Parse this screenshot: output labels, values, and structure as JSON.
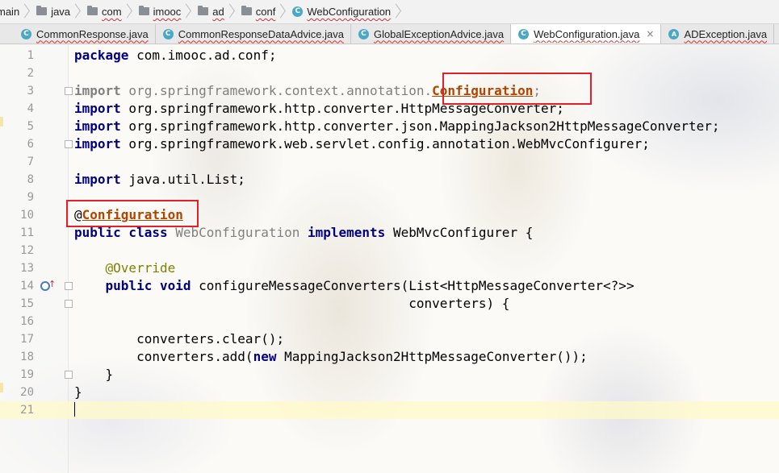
{
  "breadcrumb": [
    {
      "label": "main",
      "icon": "folder-icon"
    },
    {
      "label": "java",
      "icon": "folder-icon"
    },
    {
      "label": "com",
      "icon": "folder-icon"
    },
    {
      "label": "imooc",
      "icon": "folder-icon"
    },
    {
      "label": "ad",
      "icon": "folder-icon"
    },
    {
      "label": "conf",
      "icon": "folder-icon"
    },
    {
      "label": "WebConfiguration",
      "icon": "class-icon",
      "icon_glyph": "C"
    }
  ],
  "tabs": [
    {
      "label": "CommonResponse.java",
      "icon_glyph": "C",
      "active": false
    },
    {
      "label": "CommonResponseDataAdvice.java",
      "icon_glyph": "C",
      "active": false
    },
    {
      "label": "GlobalExceptionAdvice.java",
      "icon_glyph": "C",
      "active": false
    },
    {
      "label": "WebConfiguration.java",
      "icon_glyph": "C",
      "active": true,
      "close": "×"
    },
    {
      "label": "ADException.java",
      "icon_glyph": "A",
      "active": false
    }
  ],
  "editor": {
    "line_numbers": [
      "1",
      "2",
      "3",
      "4",
      "5",
      "6",
      "7",
      "8",
      "9",
      "10",
      "11",
      "12",
      "13",
      "14",
      "15",
      "16",
      "17",
      "18",
      "19",
      "20",
      "21"
    ],
    "code": {
      "l1_kw": "package",
      "l1_rest": " com.imooc.ad.conf;",
      "l3_kw": "import",
      "l3_pkg": " org.springframework.context.annotation.",
      "l3_cls": "Configuration",
      "l3_semi": ";",
      "l4_kw": "import",
      "l4_rest": " org.springframework.http.converter.HttpMessageConverter;",
      "l5_kw": "import",
      "l5_rest": " org.springframework.http.converter.json.MappingJackson2HttpMessageConverter;",
      "l6_kw": "import",
      "l6_rest": " org.springframework.web.servlet.config.annotation.WebMvcConfigurer;",
      "l8_kw": "import",
      "l8_rest": " java.util.List;",
      "l10_at": "@",
      "l10_name": "Configuration",
      "l11_kw1": "public class",
      "l11_name": " WebConfiguration ",
      "l11_kw2": "implements",
      "l11_rest": " WebMvcConfigurer {",
      "l13_ann": "    @Override",
      "l14_kw": "    public void",
      "l14_rest": " configureMessageConverters(List<HttpMessageConverter<?>>",
      "l15_rest": "                                           converters) {",
      "l17_rest": "        converters.clear();",
      "l18_pre": "        converters.add(",
      "l18_kw": "new",
      "l18_rest": " MappingJackson2HttpMessageConverter());",
      "l19_rest": "    }",
      "l20_rest": "}"
    }
  },
  "colors": {
    "keyword": "#000080",
    "annotation_name": "#b24400",
    "override": "#808000",
    "highlight_box": "#e0212a",
    "line_number": "#999999"
  }
}
